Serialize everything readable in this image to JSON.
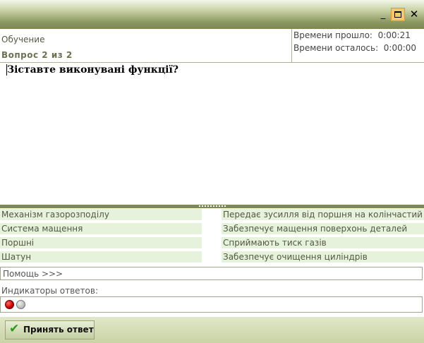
{
  "window": {
    "controls": {
      "minimize": "_",
      "close": "✕"
    }
  },
  "info": {
    "mode": "Обучение",
    "question_counter": "Вопрос  2  из  2",
    "elapsed": "Времени прошло:  0:00:21",
    "remaining": "Времени осталось:  0:00:00"
  },
  "question": {
    "text": "Зіставте виконувані функції?"
  },
  "matching": {
    "left": [
      "Механізм газорозподілу",
      "Система мащення",
      "Поршні",
      "Шатун"
    ],
    "right": [
      "Передає зусилля від поршня на колінчастий вал",
      "Забезпечує мащення поверхонь деталей",
      "Сприймають тиск газів",
      "Забезпечує очищення циліндрів"
    ]
  },
  "help": {
    "label": "Помощь >>>"
  },
  "indicators": {
    "label": "Индикаторы ответов:",
    "states": [
      "wrong",
      "unanswered"
    ],
    "colors": {
      "wrong": "#d40000",
      "unanswered": "#bdbdbd"
    }
  },
  "actions": {
    "accept_label": "Принять ответ"
  },
  "colors": {
    "accent": "#8e9a62",
    "row_bg": "#e7f2dd",
    "text": "#53583f"
  }
}
